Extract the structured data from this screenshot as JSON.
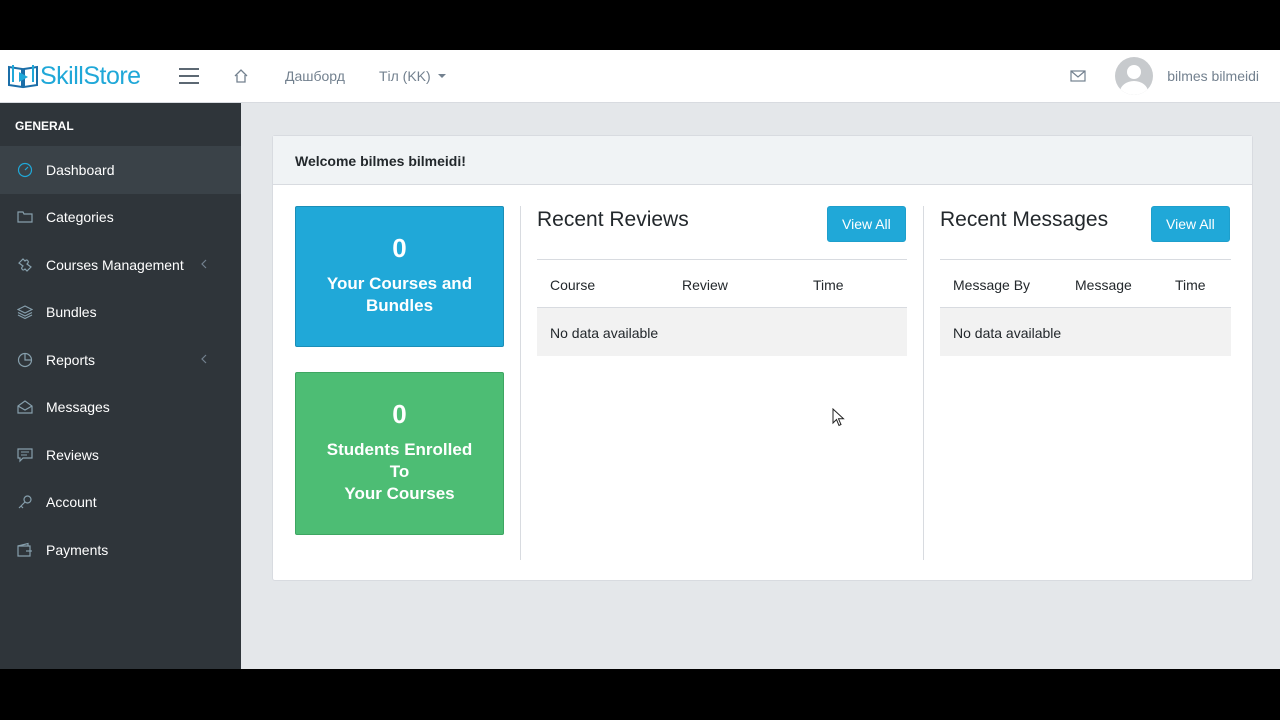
{
  "brand": {
    "name": "SkillStore",
    "color": "#20a8d8"
  },
  "nav": {
    "home_icon": "home-icon",
    "dashboard_link": "Дашборд",
    "language": "Тіл (KK)",
    "user_name": "bilmes bilmeidi"
  },
  "sidebar": {
    "section": "GENERAL",
    "items": [
      {
        "label": "Dashboard",
        "icon": "speedometer-icon",
        "active": true
      },
      {
        "label": "Categories",
        "icon": "folder-icon"
      },
      {
        "label": "Courses Management",
        "icon": "puzzle-icon",
        "has_submenu": true
      },
      {
        "label": "Bundles",
        "icon": "layers-icon"
      },
      {
        "label": "Reports",
        "icon": "pie-chart-icon",
        "has_submenu": true
      },
      {
        "label": "Messages",
        "icon": "envelope-open-icon"
      },
      {
        "label": "Reviews",
        "icon": "speech-icon"
      },
      {
        "label": "Account",
        "icon": "key-icon"
      },
      {
        "label": "Payments",
        "icon": "wallet-icon"
      }
    ]
  },
  "main": {
    "welcome": "Welcome bilmes bilmeidi!",
    "stats": [
      {
        "value": "0",
        "label": "Your Courses and Bundles",
        "color": "#20a8d8"
      },
      {
        "value": "0",
        "label": "Students Enrolled\nTo\nYour Courses",
        "color": "#4dbd74"
      }
    ],
    "reviews": {
      "title": "Recent Reviews",
      "button": "View All",
      "columns": [
        "Course",
        "Review",
        "Time"
      ],
      "empty": "No data available"
    },
    "messages": {
      "title": "Recent Messages",
      "button": "View All",
      "columns": [
        "Message By",
        "Message",
        "Time"
      ],
      "empty": "No data available"
    }
  }
}
